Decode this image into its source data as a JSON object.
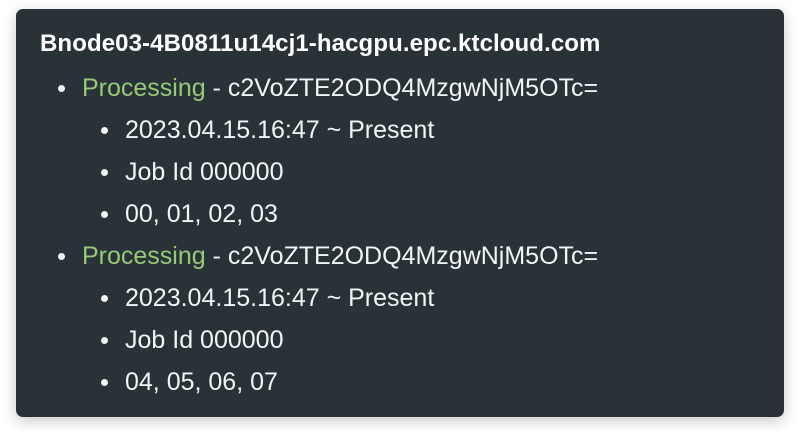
{
  "node": {
    "hostname": "Bnode03-4B0811u14cj1-hacgpu.epc.ktcloud.com"
  },
  "jobs": [
    {
      "status": "Processing",
      "separator": " - ",
      "job_key": "c2VoZTE2ODQ4MzgwNjM5OTc=",
      "period": "2023.04.15.16:47 ~ Present",
      "job_id": "Job Id 000000",
      "gpus": "00, 01, 02, 03"
    },
    {
      "status": "Processing",
      "separator": " - ",
      "job_key": "c2VoZTE2ODQ4MzgwNjM5OTc=",
      "period": "2023.04.15.16:47 ~ Present",
      "job_id": "Job Id 000000",
      "gpus": "04, 05, 06, 07"
    }
  ],
  "colors": {
    "card_background": "#283237",
    "status_processing": "#98c878",
    "text": "#f2f4f5"
  }
}
